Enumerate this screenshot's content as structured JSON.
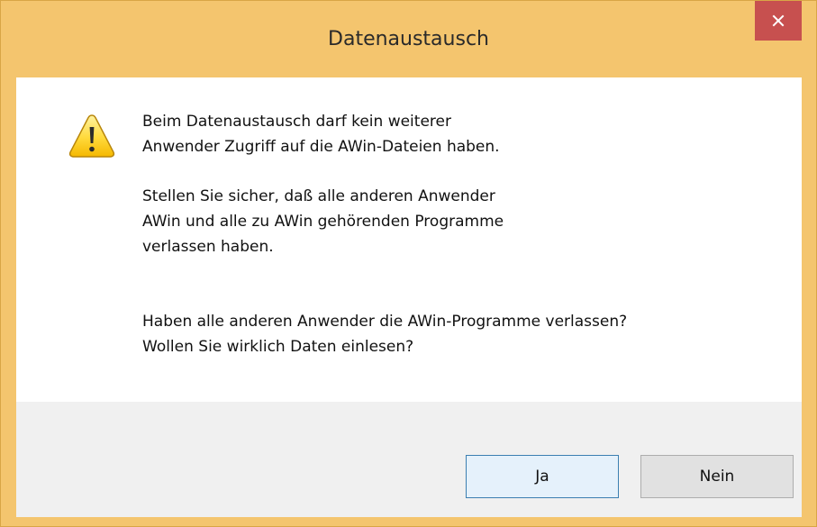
{
  "window": {
    "title": "Datenaustausch",
    "close_icon": "close-icon"
  },
  "dialog": {
    "icon": "warning-icon",
    "message": {
      "para1": [
        "Beim Datenaustausch darf kein weiterer",
        "Anwender Zugriff auf die AWin-Dateien haben."
      ],
      "para2": [
        "Stellen Sie sicher, daß alle anderen Anwender",
        "AWin und alle zu AWin gehörenden Programme",
        "verlassen haben."
      ],
      "para3": [
        "Haben alle anderen Anwender die AWin-Programme verlassen?",
        "Wollen Sie wirklich Daten einlesen?"
      ]
    }
  },
  "buttons": {
    "yes_label": "Ja",
    "no_label": "Nein"
  },
  "colors": {
    "titlebar": "#f4c56e",
    "close_button": "#c7504f",
    "footer": "#f0f0f0",
    "default_button_border": "#3c7fb1"
  }
}
